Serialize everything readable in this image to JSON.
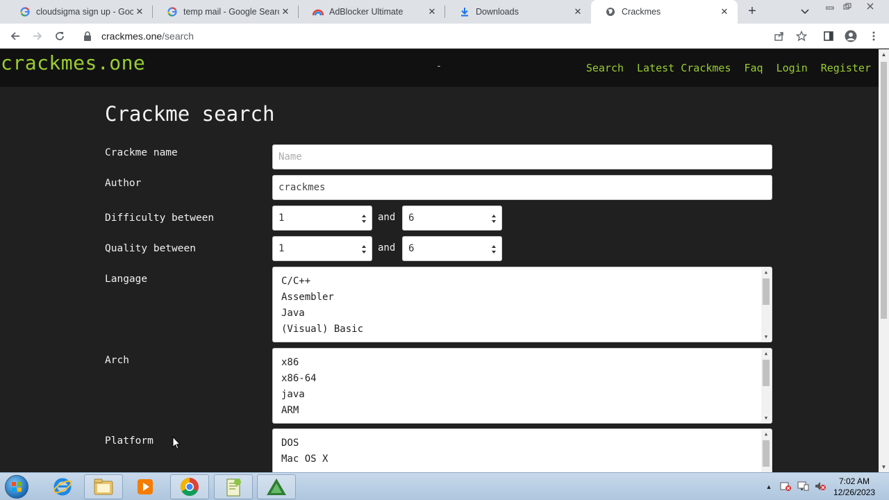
{
  "browser": {
    "tabs": [
      {
        "title": "cloudsigma sign up - Goog",
        "icon": "google-icon"
      },
      {
        "title": "temp mail - Google Search",
        "icon": "google-icon"
      },
      {
        "title": "AdBlocker Ultimate",
        "icon": "adblocker-icon"
      },
      {
        "title": "Downloads",
        "icon": "download-icon"
      },
      {
        "title": "Crackmes",
        "icon": "globe-icon",
        "active": true
      }
    ],
    "url_host": "crackmes.one",
    "url_path": "/search"
  },
  "site": {
    "brand": "crackmes.one",
    "dash": "-",
    "nav": [
      "Search",
      "Latest Crackmes",
      "Faq",
      "Login",
      "Register"
    ],
    "brand_color": "#9acd32"
  },
  "form": {
    "title": "Crackme search",
    "name_label": "Crackme name",
    "name_placeholder": "Name",
    "author_label": "Author",
    "author_value": "crackmes",
    "difficulty_label": "Difficulty between",
    "difficulty_min": "1",
    "difficulty_max": "6",
    "quality_label": "Quality between",
    "quality_min": "1",
    "quality_max": "6",
    "and_text": "and",
    "language_label": "Langage",
    "languages": [
      "C/C++",
      "Assembler",
      "Java",
      "(Visual) Basic"
    ],
    "arch_label": "Arch",
    "archs": [
      "x86",
      "x86-64",
      "java",
      "ARM"
    ],
    "platform_label": "Platform",
    "platforms": [
      "DOS",
      "Mac OS X"
    ]
  },
  "taskbar": {
    "time": "7:02 AM",
    "date": "12/26/2023"
  }
}
